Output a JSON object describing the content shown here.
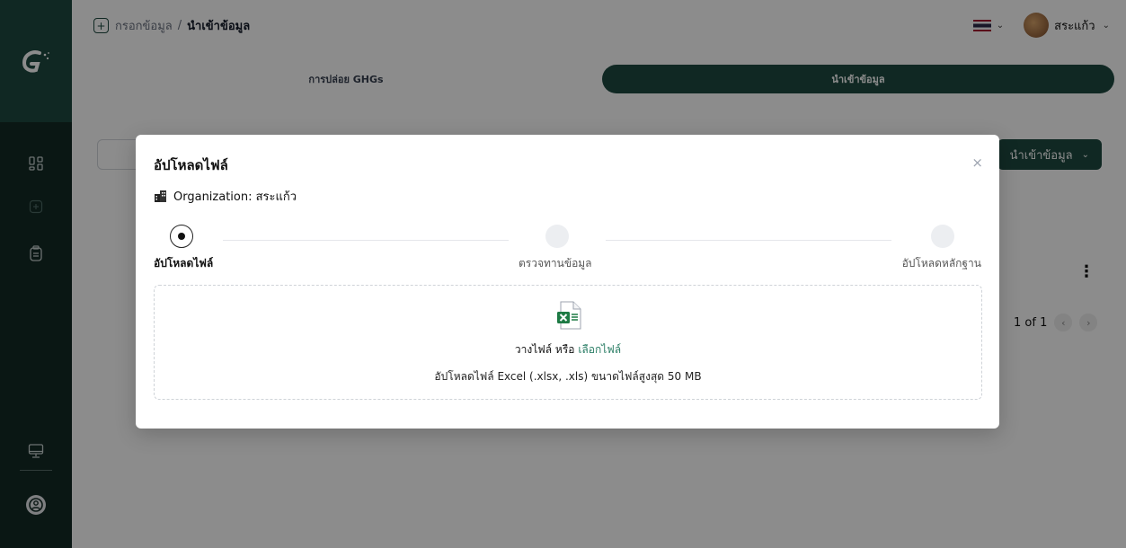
{
  "breadcrumb": {
    "parent": "กรอกข้อมูล",
    "separator": "/",
    "current": "นำเข้าข้อมูล"
  },
  "user": {
    "name": "สระแก้ว"
  },
  "tabs": [
    {
      "label": "การปล่อย GHGs",
      "active": false
    },
    {
      "label": "นำเข้าข้อมูล",
      "active": true
    }
  ],
  "background": {
    "import_button_label": "นำเข้าข้อมูล",
    "pagination": "1 of 1"
  },
  "modal": {
    "title": "อัปโหลดไฟล์",
    "close_glyph": "×",
    "organization": "Organization: สระแก้ว",
    "steps": [
      {
        "label": "อัปโหลดไฟล์",
        "state": "active"
      },
      {
        "label": "ตรวจทานข้อมูล",
        "state": "pending"
      },
      {
        "label": "อัปโหลดหลักฐาน",
        "state": "pending"
      }
    ],
    "dropzone": {
      "prompt": "วางไฟล์ หรือ",
      "link": "เลือกไฟล์",
      "hint": "อัปโหลดไฟล์ Excel (.xlsx, .xls) ขนาดไฟล์สูงสุด 50 MB"
    }
  },
  "colors": {
    "brand": "#1e4a40",
    "sidebar": "#132a26",
    "link": "#2a7d65"
  },
  "icons": [
    "app-logo-icon",
    "dashboard-icon",
    "add-icon",
    "clipboard-icon",
    "monitor-icon",
    "user-circle-icon",
    "excel-file-icon",
    "building-icon"
  ]
}
